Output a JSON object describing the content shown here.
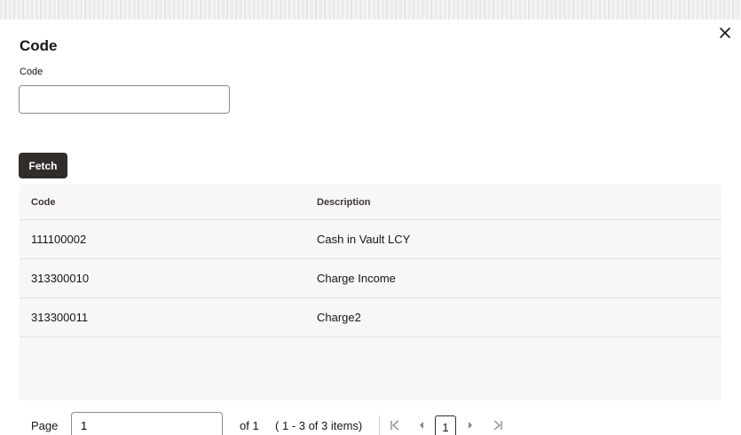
{
  "dialog": {
    "title": "Code",
    "close_icon": "close-icon"
  },
  "form": {
    "code_label": "Code",
    "code_value": "",
    "fetch_label": "Fetch"
  },
  "table": {
    "headers": [
      "Code",
      "Description"
    ],
    "rows": [
      {
        "code": "111100002",
        "description": "Cash in Vault LCY"
      },
      {
        "code": "313300010",
        "description": "Charge Income"
      },
      {
        "code": "313300011",
        "description": "Charge2"
      }
    ]
  },
  "pagination": {
    "page_label": "Page",
    "page_value": "1",
    "of_text": "of 1",
    "items_text": "( 1 - 3 of 3 items)",
    "current_page": "1",
    "first_icon": "first-page-icon",
    "prev_icon": "previous-page-icon",
    "next_icon": "next-page-icon",
    "last_icon": "last-page-icon"
  }
}
